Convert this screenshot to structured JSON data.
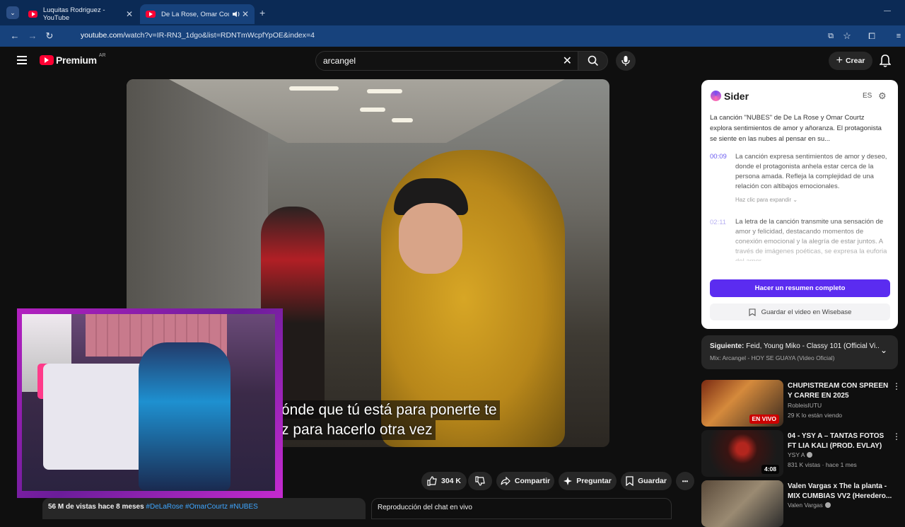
{
  "browser": {
    "tabs": [
      {
        "title": "Luquitas Rodriguez - YouTube",
        "close": "✕"
      },
      {
        "title": "De La Rose, Omar Courtz -",
        "close": "✕"
      }
    ],
    "new_tab": "+",
    "url_host": "youtube.com",
    "url_path": "/watch?v=IR-RN3_1dgo&list=RDNTmWcpfYpOE&index=4",
    "window_controls": "—"
  },
  "youtube": {
    "logo_word": "Premium",
    "logo_region": "AR",
    "search_value": "arcangel",
    "clear_label": "✕",
    "create_label": "Crear",
    "create_plus": "+"
  },
  "player": {
    "subtitle_line1": "ónde que tú está para ponerte te",
    "subtitle_line2": "z para hacerlo otra vez"
  },
  "actions": {
    "like_count": "304 K",
    "share": "Compartir",
    "ask": "Preguntar",
    "save": "Guardar",
    "more": "•••"
  },
  "description": {
    "views": "56 M de vistas  hace 8 meses",
    "tags": "#DeLaRose #OmarCourtz #NUBES"
  },
  "chat_replay": "Reproducción del chat en vivo",
  "sider": {
    "title": "Sider",
    "lang": "ES",
    "gear": "⚙",
    "intro": "La canción \"NUBES\" de De La Rose y Omar Courtz explora sentimientos de amor y añoranza. El protagonista se siente en las nubes al pensar en su...",
    "entries": [
      {
        "time": "00:09",
        "text": "La canción expresa sentimientos de amor y deseo, donde el protagonista anhela estar cerca de la persona amada. Refleja la complejidad de una relación con altibajos emocionales."
      },
      {
        "time": "02:11",
        "text": "La letra de la canción transmite una sensación de amor y felicidad, destacando momentos de conexión emocional y la alegría de estar juntos. A través de imágenes poéticas, se expresa la euforia del amor."
      }
    ],
    "expand": "Haz clic para expandir ⌄",
    "summary_button": "Hacer un resumen completo",
    "wisebase_button": "Guardar el video en Wisebase"
  },
  "up_next": {
    "label": "Siguiente:",
    "title": "Feid, Young Miko - Classy 101 (Official Vi...",
    "mix": "Mix: Arcangel - HOY SE GUAYA (Video Oficial)",
    "chevron": "⌄"
  },
  "recommendations": [
    {
      "title": "CHUPISTREAM CON SPREEN Y CARRE EN 2025",
      "channel": "RobleisIUTU",
      "meta": "29 K lo están viendo",
      "badge": "EN VIVO",
      "badge_color": "#cc0000"
    },
    {
      "title": "04 - YSY A – TANTAS FOTOS FT LIA KALI (PROD. EVLAY)",
      "channel": "YSY A",
      "meta": "831 K vistas · hace 1 mes",
      "badge": "4:08",
      "badge_color": "#000000"
    },
    {
      "title": "Valen Vargas x The la planta - MIX CUMBIAS VV2 (Heredero...",
      "channel": "Valen Vargas",
      "meta": "",
      "badge": "",
      "badge_color": "#000000"
    }
  ],
  "rec_dots": "⋮",
  "colors": {
    "tabbar": "#0b2a55",
    "addressbar": "#17427c",
    "youtube_red": "#ff0033",
    "sider_primary": "#5b2cf0",
    "cam_border": "#b320c0"
  }
}
